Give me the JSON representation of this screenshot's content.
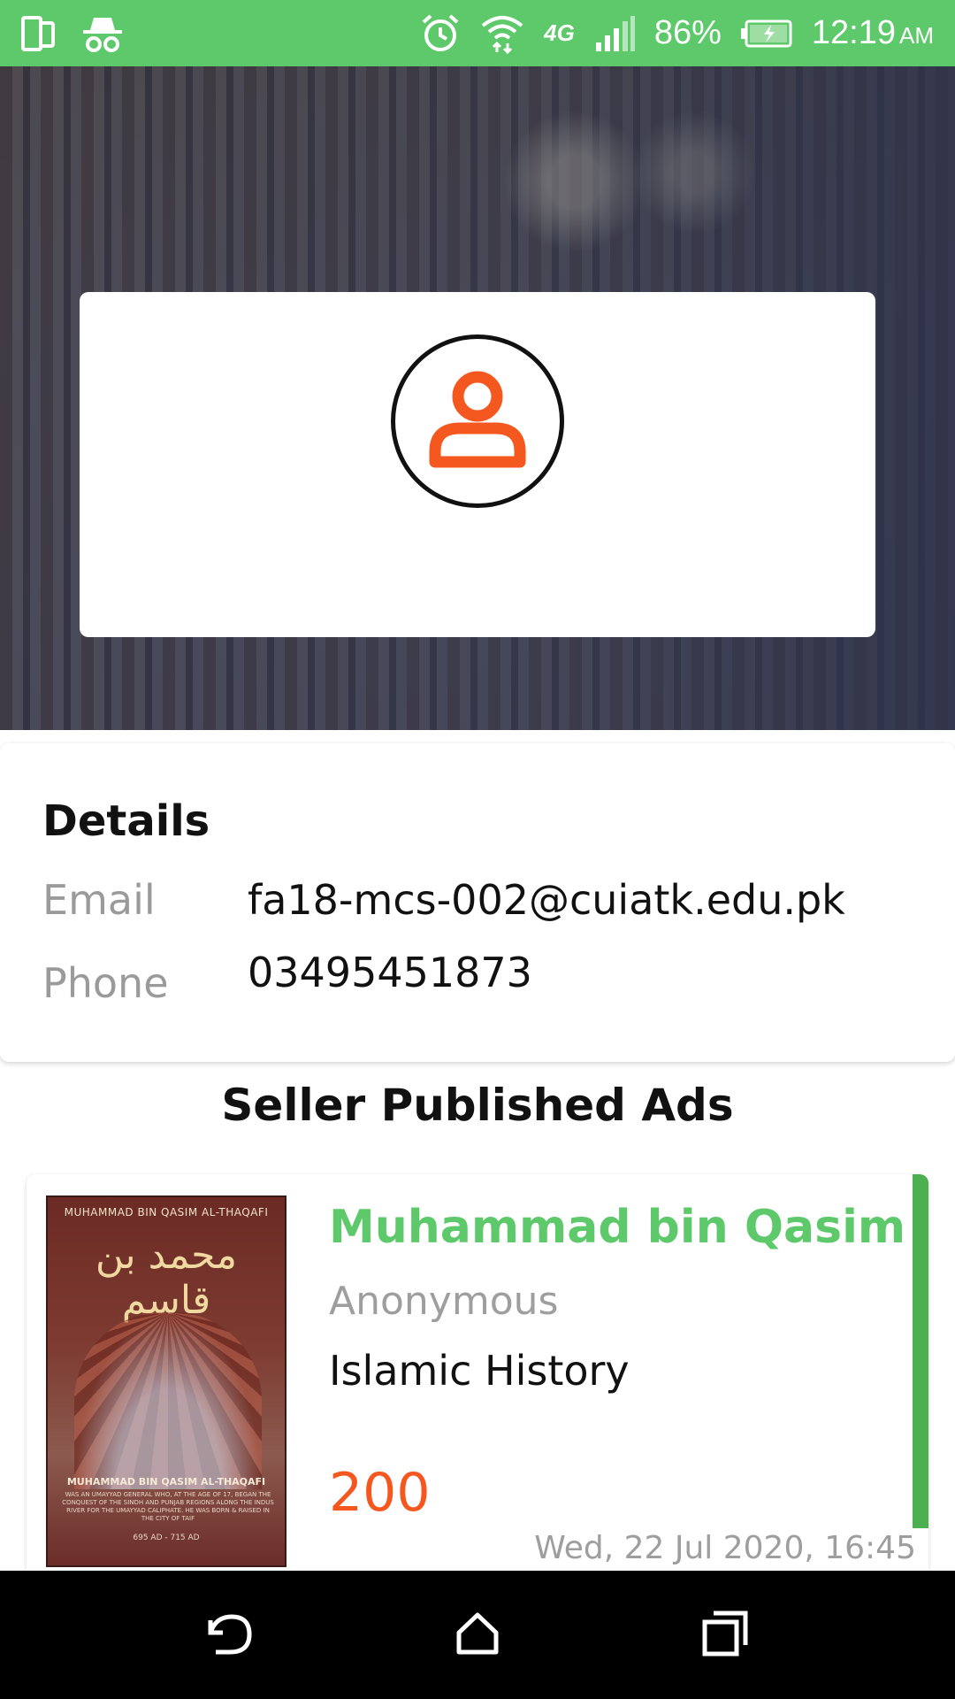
{
  "status_bar": {
    "battery": "86%",
    "time": "12:19",
    "ampm": "AM",
    "network": "4G",
    "background_color": "#5ec96a"
  },
  "profile": {
    "avatar_icon": "person-icon",
    "avatar_color": "#f5581f"
  },
  "details": {
    "title": "Details",
    "email_label": "Email",
    "email_value": "fa18-mcs-002@cuiatk.edu.pk",
    "phone_label": "Phone",
    "phone_value": "03495451873"
  },
  "ads_heading": "Seller Published Ads",
  "ads": [
    {
      "title": "Muhammad bin Qasim",
      "author": "Anonymous",
      "category": "Islamic History",
      "price": "200",
      "date": "Wed, 22 Jul 2020, 16:45",
      "cover": {
        "top_text": "MUHAMMAD BIN QASIM AL-THAQAFI",
        "arabic": "محمد بن قاسم",
        "bottom_title": "MUHAMMAD BIN QASIM AL-THAQAFI",
        "bottom_text": "WAS AN UMAYYAD GENERAL WHO, AT THE AGE OF 17, BEGAN THE CONQUEST OF THE SINDH AND PUNJAB REGIONS ALONG THE INDUS RIVER FOR THE UMAYYAD CALIPHATE. HE WAS BORN & RAISED IN THE CITY OF TAIF",
        "dates": "695 AD - 715 AD"
      }
    }
  ],
  "colors": {
    "accent_green": "#5ec96a",
    "price_orange": "#f5581f",
    "card_accent": "#4caf50"
  }
}
